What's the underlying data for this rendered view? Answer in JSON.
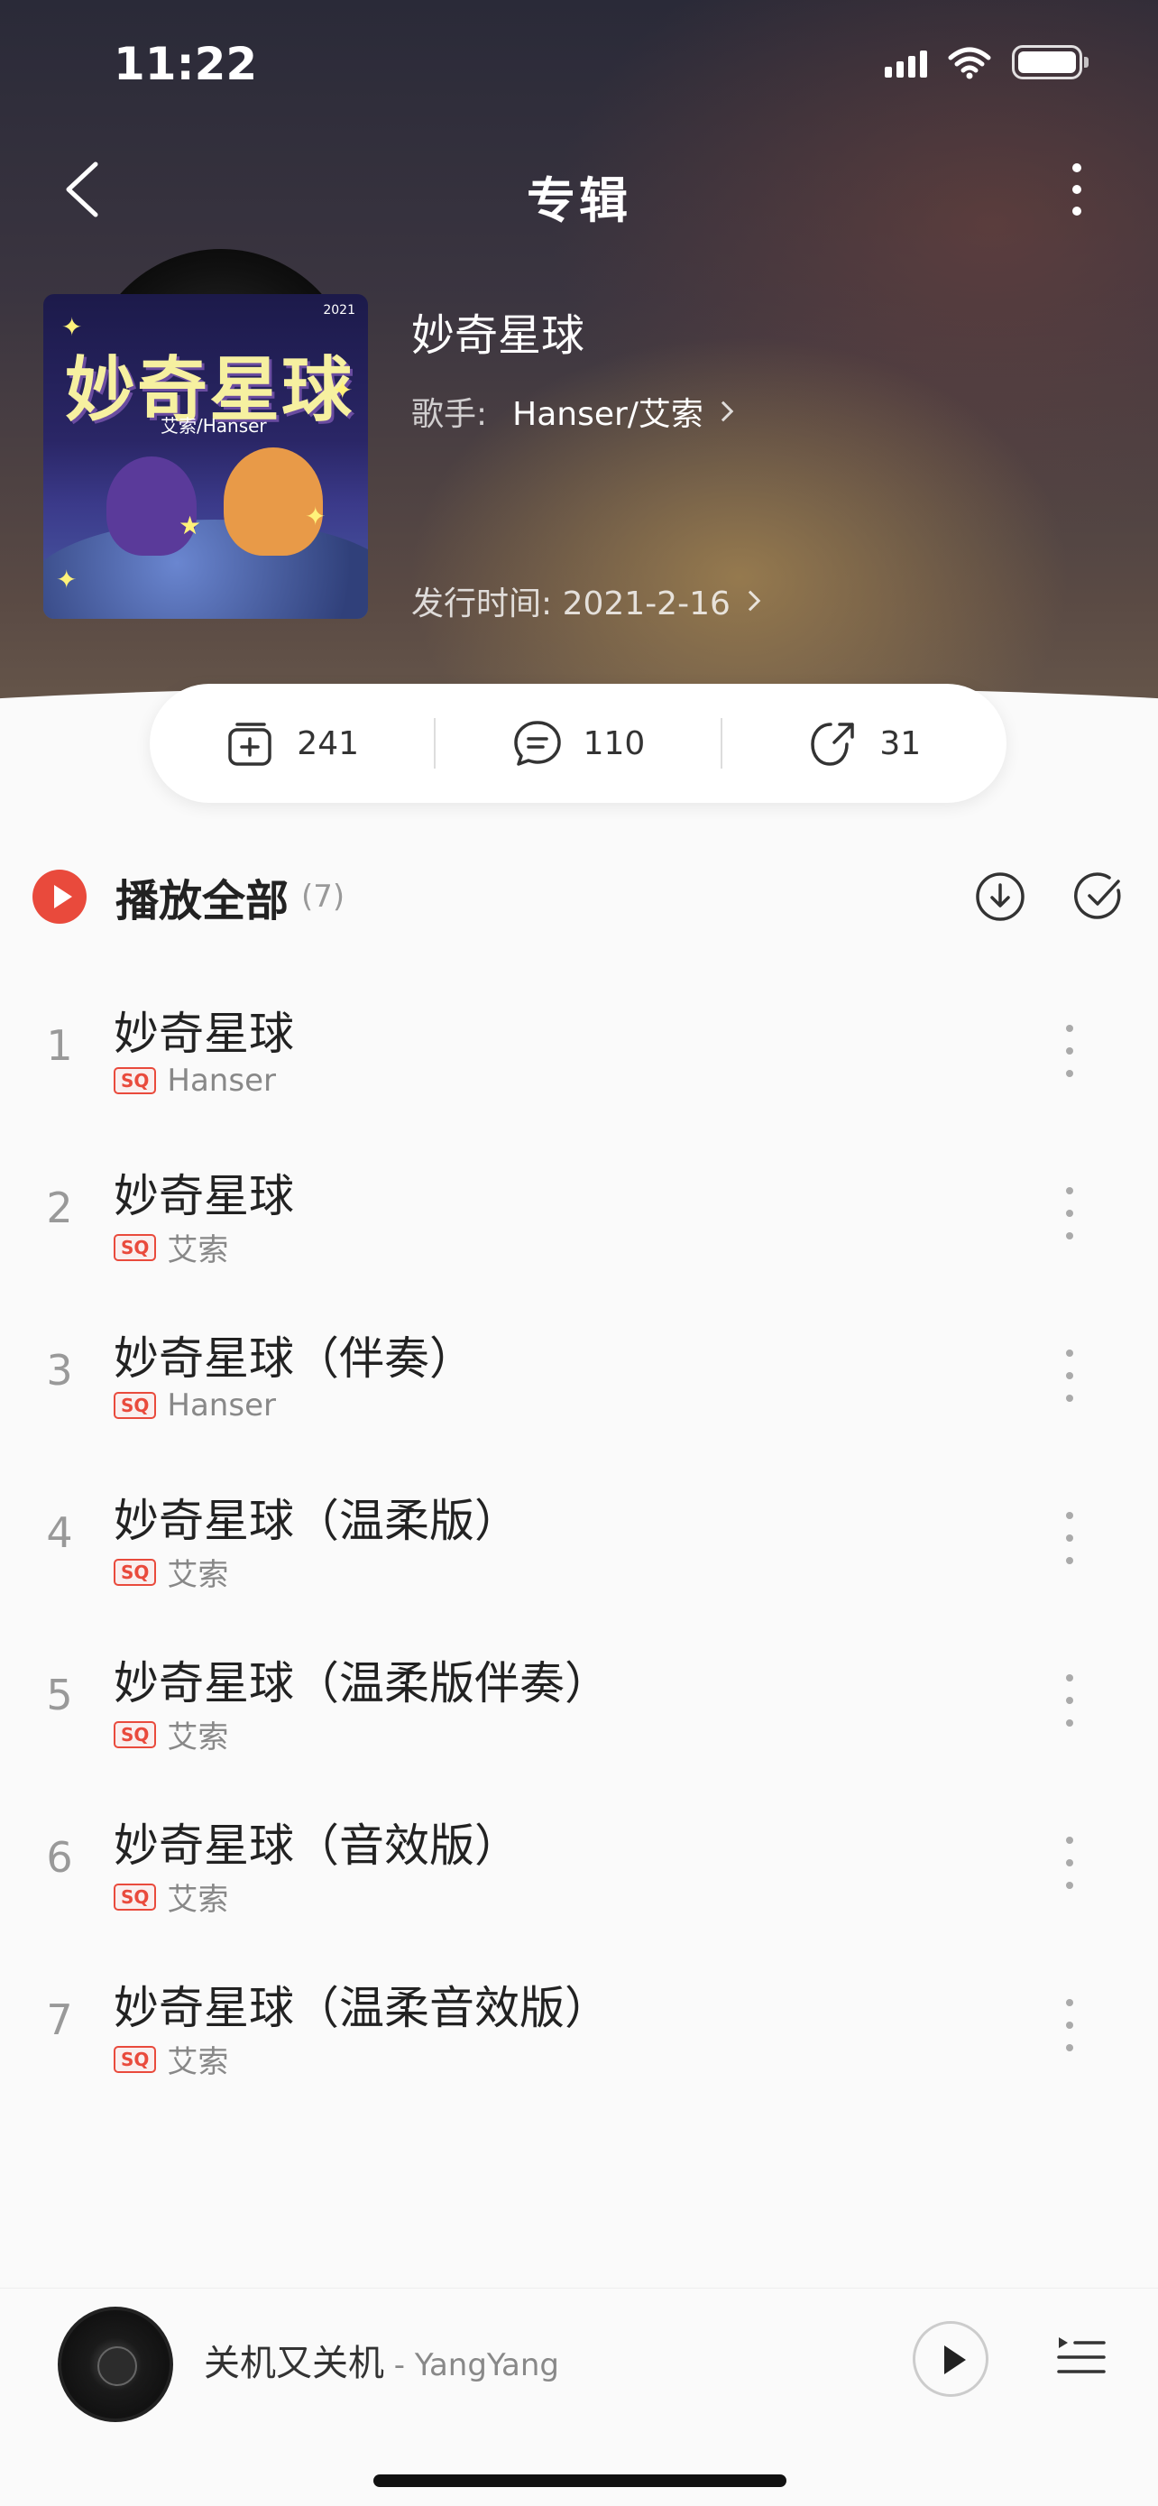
{
  "status_bar": {
    "time": "11:22"
  },
  "nav": {
    "title": "专辑"
  },
  "album": {
    "cover": {
      "year": "2021",
      "title_art": "妙奇星球",
      "subtitle_art": "艾索/Hanser"
    },
    "name": "妙奇星球",
    "artist_label": "歌手:",
    "artist": "Hanser/艾索",
    "release": "发行时间: 2021-2-16"
  },
  "stats": {
    "collect": "241",
    "comment": "110",
    "share": "31"
  },
  "play_all": {
    "label": "播放全部",
    "count": "(7)"
  },
  "tracks": [
    {
      "num": "1",
      "title": "妙奇星球",
      "quality": "SQ",
      "artist": "Hanser"
    },
    {
      "num": "2",
      "title": "妙奇星球",
      "quality": "SQ",
      "artist": "艾索"
    },
    {
      "num": "3",
      "title": "妙奇星球（伴奏）",
      "quality": "SQ",
      "artist": "Hanser"
    },
    {
      "num": "4",
      "title": "妙奇星球（温柔版）",
      "quality": "SQ",
      "artist": "艾索"
    },
    {
      "num": "5",
      "title": "妙奇星球（温柔版伴奏）",
      "quality": "SQ",
      "artist": "艾索"
    },
    {
      "num": "6",
      "title": "妙奇星球（音效版）",
      "quality": "SQ",
      "artist": "艾索"
    },
    {
      "num": "7",
      "title": "妙奇星球（温柔音效版）",
      "quality": "SQ",
      "artist": "艾索"
    }
  ],
  "mini_player": {
    "song": "关机又关机",
    "artist": " - YangYang"
  },
  "colors": {
    "accent": "#e94a3c",
    "text_primary": "#222222",
    "text_secondary": "#888888"
  }
}
